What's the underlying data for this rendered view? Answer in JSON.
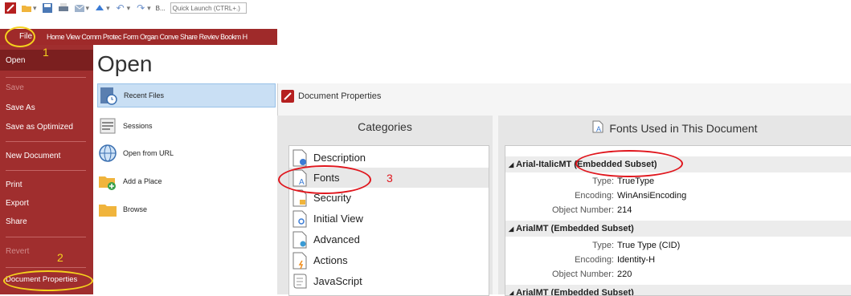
{
  "quick_access": {
    "items": [
      "app-logo-icon",
      "open-folder-icon",
      "save-icon",
      "print-icon",
      "email-icon",
      "scan-icon",
      "undo-icon",
      "redo-icon"
    ],
    "b_label": "B...",
    "search_placeholder": "Quick Launch (CTRL+.)"
  },
  "ribbon": {
    "file_label": "File",
    "tabs": [
      "Home",
      "View",
      "Comm",
      "Protec",
      "Form",
      "Organ",
      "Conve",
      "Share",
      "Reviev",
      "Bookm",
      "H"
    ]
  },
  "menu": {
    "open": "Open",
    "save": "Save",
    "save_as": "Save As",
    "save_as_optimized": "Save as Optimized",
    "new_document": "New Document",
    "print": "Print",
    "export": "Export",
    "share": "Share",
    "revert": "Revert",
    "document_properties": "Document Properties"
  },
  "open_panel": {
    "title": "Open",
    "items": [
      "Recent Files",
      "Sessions",
      "Open from URL",
      "Add a Place",
      "Browse"
    ]
  },
  "dialog": {
    "title": "Document Properties",
    "categories_header": "Categories",
    "categories": [
      "Description",
      "Fonts",
      "Security",
      "Initial View",
      "Advanced",
      "Actions",
      "JavaScript"
    ],
    "fonts_header": "Fonts Used in This Document",
    "fonts": [
      {
        "name": "Arial-ItalicMT (Embedded Subset)",
        "type": "TrueType",
        "encoding": "WinAnsiEncoding",
        "object_number": "214"
      },
      {
        "name": "ArialMT (Embedded Subset)",
        "type": "True Type (CID)",
        "encoding": "Identity-H",
        "object_number": "220"
      },
      {
        "name": "ArialMT (Embedded Subset)"
      }
    ],
    "labels": {
      "type": "Type:",
      "encoding": "Encoding:",
      "object_number": "Object Number:"
    }
  },
  "annotations": {
    "n1": "1",
    "n2": "2",
    "n3": "3"
  },
  "colors": {
    "menu": "#a02e2e",
    "ribbon": "#9f2a2a",
    "highlight": "#c9dff4",
    "red_mark": "#e0161d",
    "yellow_mark": "#f5d21d"
  }
}
